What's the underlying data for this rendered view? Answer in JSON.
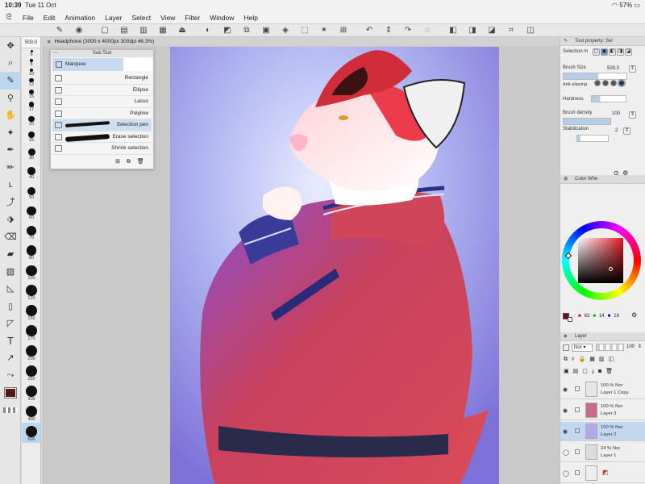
{
  "status_bar": {
    "time": "10:39",
    "date": "Tue 11 Oct",
    "battery": "57%"
  },
  "menu": [
    "File",
    "Edit",
    "Animation",
    "Layer",
    "Select",
    "View",
    "Filter",
    "Window",
    "Help"
  ],
  "document": {
    "title": "Headphone (3000 x 4000px 300dpi 46.3%)"
  },
  "brush_sizes": {
    "current": "500.0",
    "labels": [
      "6",
      "8",
      "10",
      "12",
      "15",
      "17",
      "20",
      "25",
      "30",
      "40",
      "50",
      "60",
      "70",
      "80",
      "100",
      "120",
      "150",
      "170",
      "200",
      "250",
      "300",
      "400",
      "500"
    ]
  },
  "subtool": {
    "header": "Sub Tool",
    "tab": "Marquee",
    "items": [
      "Rectangle",
      "Ellipse",
      "Lasso",
      "Polyline",
      "Selection pen",
      "Erase selection",
      "Shrink selection"
    ],
    "selected": "Selection pen"
  },
  "tool_property": {
    "tab_label": "Tool property: Sel",
    "selection_label": "Selection m",
    "brush_size_label": "Brush Size",
    "brush_size_value": "500.0",
    "antialias_label": "Anti-aliasing",
    "hardness_label": "Hardness",
    "brush_density_label": "Brush density",
    "brush_density_value": "100",
    "stabilization_label": "Stabilization",
    "stabilization_value": "2"
  },
  "color_wheel": {
    "tab_label": "Color Whe",
    "values": [
      "63",
      "14",
      "16"
    ],
    "main_color": "#5a1518",
    "sub_color": "#ffffff"
  },
  "layers": {
    "tab_label": "Layer",
    "blend_mode": "Nor",
    "opacity": "100",
    "items": [
      {
        "opacity": "100 %",
        "mode": "Nor",
        "name": "Layer 1 Copy"
      },
      {
        "opacity": "100 %",
        "mode": "Nor",
        "name": "Layer 3"
      },
      {
        "opacity": "100 %",
        "mode": "Nor",
        "name": "Layer 2"
      },
      {
        "opacity": "24 %",
        "mode": "Nor",
        "name": "Layer 1"
      }
    ]
  }
}
